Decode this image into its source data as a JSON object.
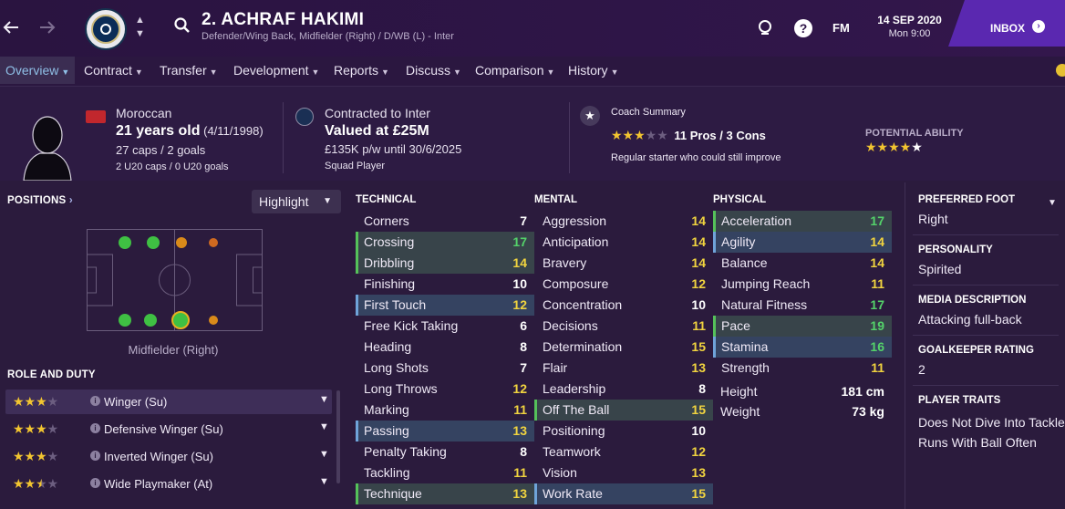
{
  "header": {
    "player_name": "2. ACHRAF HAKIMI",
    "player_positions": "Defender/Wing Back, Midfielder (Right) / D/WB (L) - Inter",
    "fm_label": "FM",
    "date": "14 SEP 2020",
    "time": "Mon 9:00",
    "inbox_label": "INBOX"
  },
  "tabs": [
    "Overview",
    "Contract",
    "Transfer",
    "Development",
    "Reports",
    "Discuss",
    "Comparison",
    "History"
  ],
  "info": {
    "nationality": "Moroccan",
    "age": "21 years old",
    "dob": "(4/11/1998)",
    "caps": "27 caps / 2 goals",
    "u20_caps": "2 U20 caps / 0 U20 goals",
    "contracted_to": "Contracted to Inter",
    "valued_at": "Valued at £25M",
    "wage": "£135K p/w until 30/6/2025",
    "squad_status": "Squad Player",
    "coach_summary_title": "Coach Summary",
    "pros_cons": "11 Pros / 3 Cons",
    "coach_comment": "Regular starter who could still improve",
    "coach_stars": 3,
    "potential_title": "POTENTIAL ABILITY",
    "potential_stars": 4.5
  },
  "left": {
    "positions_title": "POSITIONS",
    "highlight_label": "Highlight",
    "position_label": "Midfielder (Right)",
    "role_title": "ROLE AND DUTY",
    "roles": [
      {
        "name": "Winger (Su)",
        "stars": 3
      },
      {
        "name": "Defensive Winger (Su)",
        "stars": 3
      },
      {
        "name": "Inverted Winger (Su)",
        "stars": 3
      },
      {
        "name": "Wide Playmaker (At)",
        "stars": 2.5
      }
    ]
  },
  "attributes": {
    "technical_title": "TECHNICAL",
    "mental_title": "MENTAL",
    "physical_title": "PHYSICAL",
    "technical": [
      {
        "name": "Corners",
        "value": "7",
        "hl": ""
      },
      {
        "name": "Crossing",
        "value": "17",
        "hl": "g"
      },
      {
        "name": "Dribbling",
        "value": "14",
        "hl": "g"
      },
      {
        "name": "Finishing",
        "value": "10",
        "hl": ""
      },
      {
        "name": "First Touch",
        "value": "12",
        "hl": "b"
      },
      {
        "name": "Free Kick Taking",
        "value": "6",
        "hl": ""
      },
      {
        "name": "Heading",
        "value": "8",
        "hl": ""
      },
      {
        "name": "Long Shots",
        "value": "7",
        "hl": ""
      },
      {
        "name": "Long Throws",
        "value": "12",
        "hl": ""
      },
      {
        "name": "Marking",
        "value": "11",
        "hl": ""
      },
      {
        "name": "Passing",
        "value": "13",
        "hl": "b"
      },
      {
        "name": "Penalty Taking",
        "value": "8",
        "hl": ""
      },
      {
        "name": "Tackling",
        "value": "11",
        "hl": ""
      },
      {
        "name": "Technique",
        "value": "13",
        "hl": "g"
      }
    ],
    "mental": [
      {
        "name": "Aggression",
        "value": "14",
        "hl": ""
      },
      {
        "name": "Anticipation",
        "value": "14",
        "hl": ""
      },
      {
        "name": "Bravery",
        "value": "14",
        "hl": ""
      },
      {
        "name": "Composure",
        "value": "12",
        "hl": ""
      },
      {
        "name": "Concentration",
        "value": "10",
        "hl": ""
      },
      {
        "name": "Decisions",
        "value": "11",
        "hl": ""
      },
      {
        "name": "Determination",
        "value": "15",
        "hl": ""
      },
      {
        "name": "Flair",
        "value": "13",
        "hl": ""
      },
      {
        "name": "Leadership",
        "value": "8",
        "hl": ""
      },
      {
        "name": "Off The Ball",
        "value": "15",
        "hl": "g"
      },
      {
        "name": "Positioning",
        "value": "10",
        "hl": ""
      },
      {
        "name": "Teamwork",
        "value": "12",
        "hl": ""
      },
      {
        "name": "Vision",
        "value": "13",
        "hl": ""
      },
      {
        "name": "Work Rate",
        "value": "15",
        "hl": "b"
      }
    ],
    "physical": [
      {
        "name": "Acceleration",
        "value": "17",
        "hl": "g"
      },
      {
        "name": "Agility",
        "value": "14",
        "hl": "b"
      },
      {
        "name": "Balance",
        "value": "14",
        "hl": ""
      },
      {
        "name": "Jumping Reach",
        "value": "11",
        "hl": ""
      },
      {
        "name": "Natural Fitness",
        "value": "17",
        "hl": ""
      },
      {
        "name": "Pace",
        "value": "19",
        "hl": "g"
      },
      {
        "name": "Stamina",
        "value": "16",
        "hl": "b"
      },
      {
        "name": "Strength",
        "value": "11",
        "hl": ""
      }
    ],
    "height_label": "Height",
    "height": "181 cm",
    "weight_label": "Weight",
    "weight": "73 kg"
  },
  "right": {
    "foot_title": "PREFERRED FOOT",
    "foot": "Right",
    "personality_title": "PERSONALITY",
    "personality": "Spirited",
    "media_title": "MEDIA DESCRIPTION",
    "media": "Attacking full-back",
    "gk_title": "GOALKEEPER RATING",
    "gk": "2",
    "traits_title": "PLAYER TRAITS",
    "traits": [
      "Does Not Dive Into Tackles",
      "Runs With Ball Often"
    ]
  },
  "colors": {
    "accent": "#5a28b0",
    "star": "#f2c530",
    "green": "#54d36a",
    "yellow": "#f1d43f"
  }
}
